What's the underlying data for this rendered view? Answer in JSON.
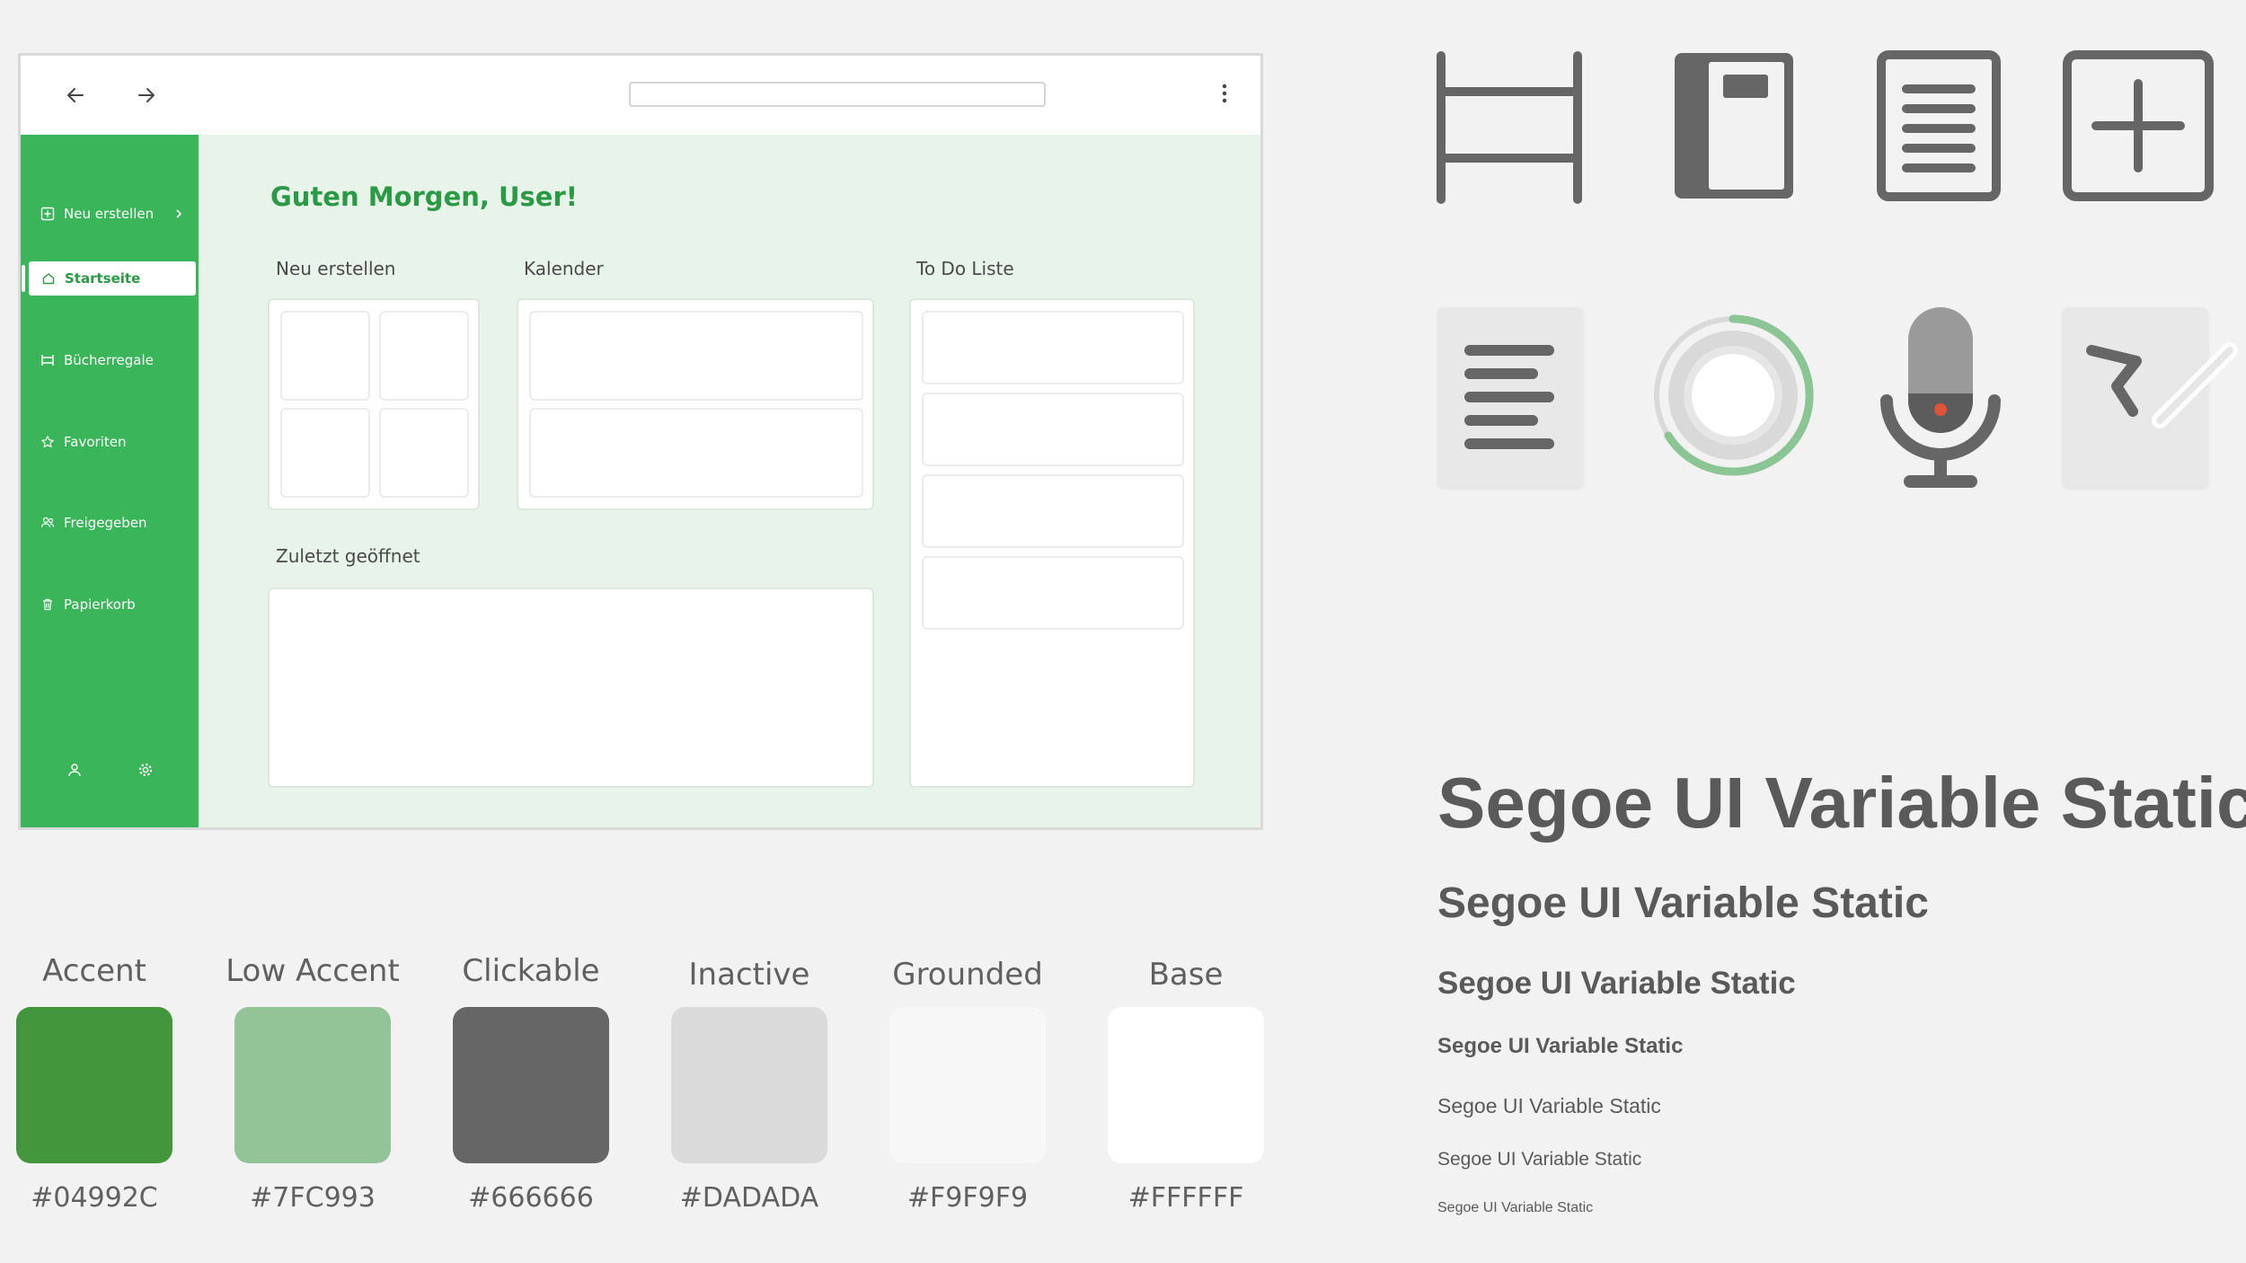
{
  "browser": {
    "back_icon": "arrow-left-icon",
    "forward_icon": "arrow-right-icon",
    "address_value": "",
    "menu_icon": "more-vertical-icon"
  },
  "sidebar": {
    "items": [
      {
        "label": "Neu erstellen",
        "icon": "add-square-icon",
        "chevron": "chevron-right-icon"
      },
      {
        "label": "Startseite",
        "icon": "home-icon",
        "active": true
      },
      {
        "label": "Bücherregale",
        "icon": "bookshelf-icon"
      },
      {
        "label": "Favoriten",
        "icon": "star-icon"
      },
      {
        "label": "Freigegeben",
        "icon": "people-icon"
      },
      {
        "label": "Papierkorb",
        "icon": "trash-icon"
      }
    ],
    "footer_icons": [
      "person-icon",
      "settings-icon"
    ]
  },
  "main": {
    "greeting": "Guten Morgen, User!",
    "sections": {
      "create": "Neu erstellen",
      "calendar": "Kalender",
      "todo": "To Do Liste",
      "recent": "Zuletzt geöffnet"
    }
  },
  "icons": [
    "bookshelf-icon",
    "notebook-icon",
    "document-lines-icon",
    "add-square-icon",
    "text-document-icon",
    "loading-ring-icon",
    "microphone-icon",
    "pen-drawing-icon"
  ],
  "palette": [
    {
      "name": "Accent",
      "hex": "#04992C",
      "color": "#43963c"
    },
    {
      "name": "Low Accent",
      "hex": "#7FC993",
      "color": "#92c497"
    },
    {
      "name": "Clickable",
      "hex": "#666666",
      "color": "#666666"
    },
    {
      "name": "Inactive",
      "hex": "#DADADA",
      "color": "#dadada"
    },
    {
      "name": "Grounded",
      "hex": "#F9F9F9",
      "color": "#f7f7f7"
    },
    {
      "name": "Base",
      "hex": "#FFFFFF",
      "color": "#ffffff"
    }
  ],
  "typography": {
    "samples": [
      "Segoe UI Variable Static",
      "Segoe UI Variable Static",
      "Segoe UI Variable Static",
      "Segoe UI Variable Static",
      "Segoe UI Variable Static",
      "Segoe UI Variable Static",
      "Segoe UI Variable Static"
    ]
  }
}
